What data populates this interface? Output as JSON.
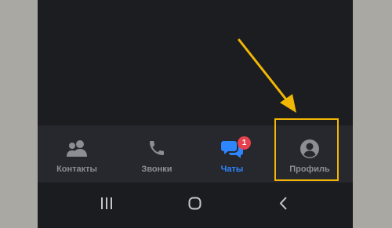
{
  "tab_bar": {
    "tabs": [
      {
        "id": "contacts",
        "label": "Контакты",
        "icon": "contacts-icon",
        "active": false
      },
      {
        "id": "calls",
        "label": "Звонки",
        "icon": "phone-icon",
        "active": false
      },
      {
        "id": "chats",
        "label": "Чаты",
        "icon": "chat-bubbles-icon",
        "active": true,
        "badge": "1"
      },
      {
        "id": "profile",
        "label": "Профиль",
        "icon": "profile-icon",
        "active": false
      }
    ]
  },
  "navigation_bar": {
    "buttons": [
      {
        "id": "recents",
        "icon": "recents-icon"
      },
      {
        "id": "home",
        "icon": "home-icon"
      },
      {
        "id": "back",
        "icon": "back-icon"
      }
    ]
  },
  "colors": {
    "background_outer": "#a9a8a3",
    "app_background": "#1c1d21",
    "tab_bar": "#27282d",
    "active_tab": "#2d86ff",
    "inactive_tab": "#8d8e93",
    "badge": "#e5414f",
    "annotation": "#f2b705"
  }
}
